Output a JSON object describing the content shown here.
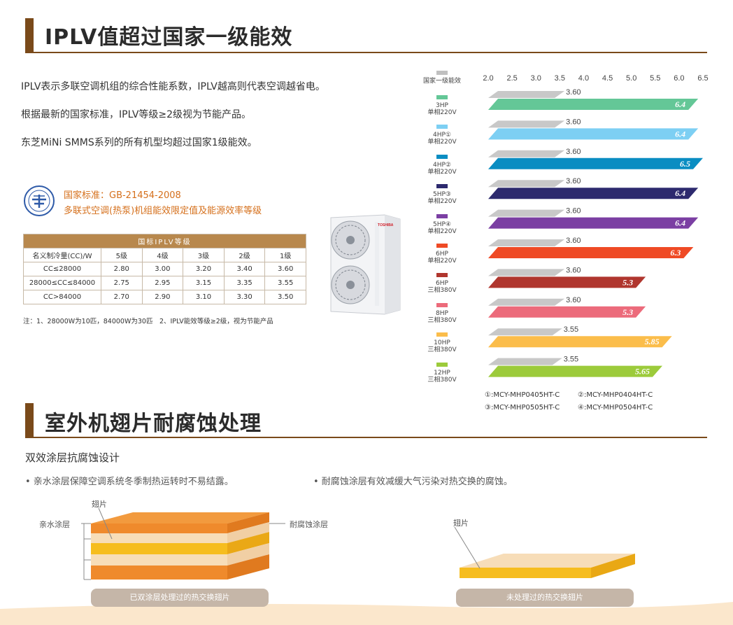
{
  "section1": {
    "title": "IPLV值超过国家一级能效",
    "paragraphs": [
      "IPLV表示多联空调机组的综合性能系数，IPLV越高则代表空调越省电。",
      "根据最新的国家标准，IPLV等级≥2级视为节能产品。",
      "东芝MiNi SMMS系列的所有机型均超过国家1级能效。"
    ],
    "standard_line1": "国家标准：GB-21454-2008",
    "standard_line2": "多联式空调(热泵)机组能效限定值及能源效率等级",
    "table": {
      "header": "国标IPLV等级",
      "columns": [
        "名义制冷量(CC)/W",
        "5级",
        "4级",
        "3级",
        "2级",
        "1级"
      ],
      "rows": [
        [
          "CC≤28000",
          "2.80",
          "3.00",
          "3.20",
          "3.40",
          "3.60"
        ],
        [
          "28000≤CC≤84000",
          "2.75",
          "2.95",
          "3.15",
          "3.35",
          "3.55"
        ],
        [
          "CC>84000",
          "2.70",
          "2.90",
          "3.10",
          "3.30",
          "3.50"
        ]
      ]
    },
    "note": "注：1、28000W为10匹，84000W为30匹　2、IPLV能效等级≥2级，视为节能产品",
    "brand": "TOSHIBA"
  },
  "chart_data": {
    "type": "bar",
    "orientation": "horizontal",
    "x_ticks": [
      "2.0",
      "2.5",
      "3.0",
      "3.5",
      "4.0",
      "4.5",
      "5.0",
      "5.5",
      "6.0",
      "6.5"
    ],
    "xlim": [
      2.0,
      6.5
    ],
    "legend_reference": "国家一级能效",
    "reference_color": "#c0c0c0",
    "categories": [
      {
        "label": "3HP",
        "sub": "单相220V",
        "reference": 3.6,
        "value": 6.4,
        "value_label": "6.4",
        "ref_label": "3.60",
        "color": "#64c797"
      },
      {
        "label": "4HP①",
        "sub": "单相220V",
        "reference": 3.6,
        "value": 6.4,
        "value_label": "6.4",
        "ref_label": "3.60",
        "color": "#7dcff3"
      },
      {
        "label": "4HP②",
        "sub": "单相220V",
        "reference": 3.6,
        "value": 6.5,
        "value_label": "6.5",
        "ref_label": "3.60",
        "color": "#0a8dc2"
      },
      {
        "label": "5HP③",
        "sub": "单相220V",
        "reference": 3.6,
        "value": 6.4,
        "value_label": "6.4",
        "ref_label": "3.60",
        "color": "#2d2a6e"
      },
      {
        "label": "5HP④",
        "sub": "单相220V",
        "reference": 3.6,
        "value": 6.4,
        "value_label": "6.4",
        "ref_label": "3.60",
        "color": "#7b3fa3"
      },
      {
        "label": "6HP",
        "sub": "单相220V",
        "reference": 3.6,
        "value": 6.3,
        "value_label": "6.3",
        "ref_label": "3.60",
        "color": "#ef4a25"
      },
      {
        "label": "6HP",
        "sub": "三相380V",
        "reference": 3.6,
        "value": 5.3,
        "value_label": "5.3",
        "ref_label": "3.60",
        "color": "#b0362e"
      },
      {
        "label": "8HP",
        "sub": "三相380V",
        "reference": 3.6,
        "value": 5.3,
        "value_label": "5.3",
        "ref_label": "3.60",
        "color": "#ec6b7b"
      },
      {
        "label": "10HP",
        "sub": "三相380V",
        "reference": 3.55,
        "value": 5.85,
        "value_label": "5.85",
        "ref_label": "3.55",
        "color": "#fbbd4b"
      },
      {
        "label": "12HP",
        "sub": "三相380V",
        "reference": 3.55,
        "value": 5.65,
        "value_label": "5.65",
        "ref_label": "3.55",
        "color": "#9ccb3b"
      }
    ],
    "models": [
      "①:MCY-MHP0405HT-C",
      "②:MCY-MHP0404HT-C",
      "③:MCY-MHP0505HT-C",
      "④:MCY-MHP0504HT-C"
    ]
  },
  "section2": {
    "title": "室外机翅片耐腐蚀处理",
    "subtitle": "双效涂层抗腐蚀设计",
    "bullet1": "• 亲水涂层保障空调系统冬季制热运转时不易结露。",
    "bullet2": "• 耐腐蚀涂层有效减缓大气污染对热交换的腐蚀。",
    "label_fin": "翅片",
    "label_hydro": "亲水涂层",
    "label_anticorr": "耐腐蚀涂层",
    "label_fin2": "翅片",
    "button1": "已双涂层处理过的热交换翅片",
    "button2": "未处理过的热交换翅片",
    "colors": {
      "orange": "#ef8a2c",
      "yellow": "#f6bd1f",
      "cream": "#f7ddb8"
    }
  }
}
